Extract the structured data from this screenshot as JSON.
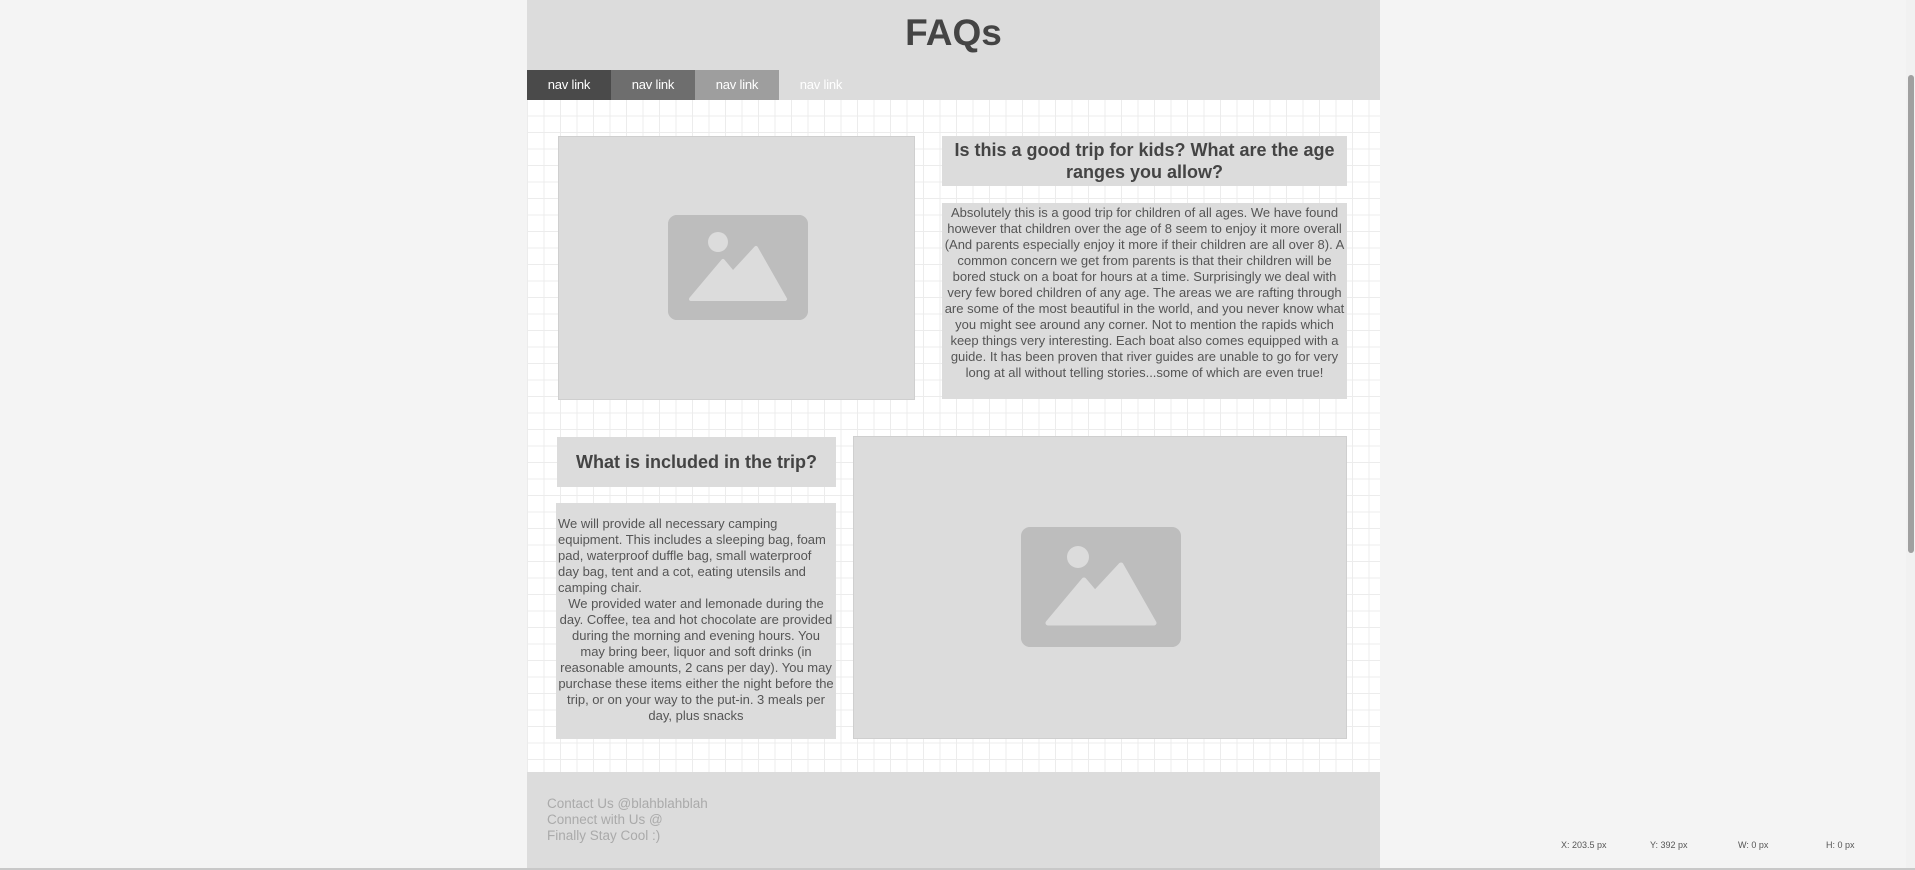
{
  "header": {
    "title": "FAQs",
    "nav": [
      {
        "label": "nav link",
        "bg": "#4a4a4a"
      },
      {
        "label": "nav link",
        "bg": "#6e6e6e"
      },
      {
        "label": "nav link",
        "bg": "#9e9e9e"
      },
      {
        "label": "nav link",
        "bg": "#dcdcdc"
      }
    ]
  },
  "faqs": [
    {
      "question": "Is this a good trip for kids? What are the age ranges you allow?",
      "answer": "Absolutely this is a good trip for children of all ages. We have found however that children over the age of 8 seem to enjoy it more overall (And parents especially enjoy it more if their children are all over 8). A common concern we get from parents is that their children will be bored stuck on a boat for hours at a time. Surprisingly we deal with very few bored children of any age. The areas we are rafting through are some of the most beautiful in the world, and you never know what you might see around any corner. Not to mention the rapids which keep things very interesting. Each boat also comes equipped with a guide. It has been proven that river guides are unable to go for very long at all without telling stories...some of which are even true!",
      "image_icon": "image-placeholder-icon"
    },
    {
      "question": "What is included in the trip?",
      "answer_part1": "We will provide all necessary camping equipment. This includes a sleeping bag, foam pad, waterproof duffle bag, small waterproof day bag, tent and a cot, eating utensils and camping chair.",
      "answer_part2": "We provided water and lemonade during the day. Coffee, tea and hot chocolate are provided during the morning and evening hours. You may bring beer, liquor and soft drinks (in reasonable amounts, 2 cans per day). You may purchase these items either the night before the trip, or on your way to the put-in. 3 meals per day, plus snacks",
      "image_icon": "image-placeholder-icon"
    }
  ],
  "footer": {
    "lines": [
      "Contact Us @blahblahblah",
      "Connect with Us @",
      "Finally Stay Cool :)"
    ]
  },
  "inspector": {
    "x": "X: 203.5 px",
    "y": "Y: 392 px",
    "w": "W: 0 px",
    "h": "H: 0 px"
  },
  "colors": {
    "panel": "#dcdcdc",
    "placeholder": "#bdbdbd",
    "heading_text": "#444444"
  }
}
